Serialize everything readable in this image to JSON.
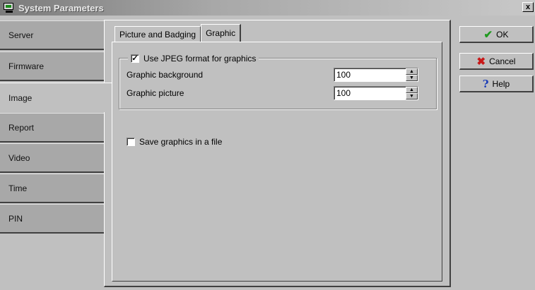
{
  "window": {
    "title": "System Parameters",
    "close_glyph": "x"
  },
  "sidebar": {
    "items": [
      {
        "label": "Server"
      },
      {
        "label": "Firmware"
      },
      {
        "label": "Image"
      },
      {
        "label": "Report"
      },
      {
        "label": "Video"
      },
      {
        "label": "Time"
      },
      {
        "label": "PIN"
      }
    ],
    "active": "Image"
  },
  "tabs": [
    {
      "label": "Picture and Badging"
    },
    {
      "label": "Graphic"
    }
  ],
  "active_tab": "Graphic",
  "graphic": {
    "use_jpeg": {
      "label": "Use JPEG format for graphics",
      "checked": true,
      "check_glyph": "✓"
    },
    "background": {
      "label": "Graphic background",
      "value": "100"
    },
    "picture": {
      "label": "Graphic picture",
      "value": "100"
    },
    "save_file": {
      "label": "Save graphics in a file",
      "checked": false
    }
  },
  "buttons": {
    "ok": {
      "label": "OK",
      "icon": "checkmark-icon"
    },
    "cancel": {
      "label": "Cancel",
      "icon": "x-icon"
    },
    "help": {
      "label": "Help",
      "icon": "question-icon"
    }
  },
  "colors": {
    "ok_icon": "#1f9a1f",
    "cancel_icon": "#c81818",
    "help_icon": "#1a3cb8"
  }
}
